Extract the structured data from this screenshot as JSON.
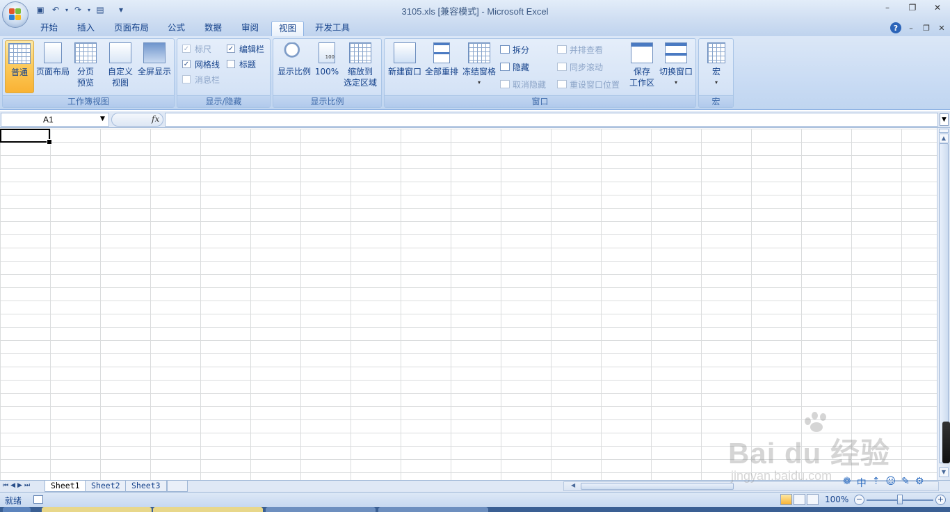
{
  "window": {
    "title": "3105.xls  [兼容模式] - Microsoft Excel",
    "controls": {
      "minimize": "–",
      "maximize": "❐",
      "close": "✕"
    }
  },
  "quick_access": {
    "icons": [
      "save-icon",
      "undo-icon",
      "redo-icon",
      "print-preview-icon",
      "customize-dropdown-icon"
    ],
    "glyphs": {
      "save": "▣",
      "undo": "↶",
      "redo": "↷",
      "preview": "▤",
      "customize": "▾",
      "sep": "▾"
    }
  },
  "tabs": [
    {
      "label": "开始"
    },
    {
      "label": "插入"
    },
    {
      "label": "页面布局"
    },
    {
      "label": "公式"
    },
    {
      "label": "数据"
    },
    {
      "label": "审阅"
    },
    {
      "label": "视图",
      "active": true
    },
    {
      "label": "开发工具"
    }
  ],
  "mdi_controls": {
    "help": "?",
    "minimize": "–",
    "restore": "❐",
    "close": "✕"
  },
  "ribbon": {
    "workbook_views": {
      "group_label": "工作簿视图",
      "normal": "普通",
      "page_layout": "页面布局",
      "page_break_1": "分页",
      "page_break_2": "预览",
      "custom_1": "自定义",
      "custom_2": "视图",
      "full_screen": "全屏显示"
    },
    "show_hide": {
      "group_label": "显示/隐藏",
      "ruler": "标尺",
      "gridlines": "网格线",
      "message_bar": "消息栏",
      "formula_bar": "编辑栏",
      "headings": "标题",
      "check": "✓"
    },
    "zoom": {
      "group_label": "显示比例",
      "zoom": "显示比例",
      "hundred": "100%",
      "hundred_icon_text": "100",
      "zoom_selection_1": "缩放到",
      "zoom_selection_2": "选定区域"
    },
    "window": {
      "group_label": "窗口",
      "new_window": "新建窗口",
      "arrange_all": "全部重排",
      "freeze_panes": "冻结窗格",
      "split": "拆分",
      "hide": "隐藏",
      "unhide": "取消隐藏",
      "side_by_side": "并排查看",
      "sync_scroll": "同步滚动",
      "reset_position": "重设窗口位置",
      "save_workspace_1": "保存",
      "save_workspace_2": "工作区",
      "switch_windows": "切换窗口",
      "dropdown": "▾"
    },
    "macros": {
      "group_label": "宏",
      "macros": "宏",
      "dropdown": "▾"
    }
  },
  "formula_bar": {
    "name_box": "A1",
    "name_box_arrow": "▼",
    "fx": "fx",
    "expand": "▼",
    "value": ""
  },
  "sheet_tabs": {
    "nav": [
      "⏮",
      "◀",
      "▶",
      "⏭"
    ],
    "tabs": [
      {
        "label": "Sheet1",
        "active": true
      },
      {
        "label": "Sheet2"
      },
      {
        "label": "Sheet3"
      }
    ]
  },
  "scrollbars": {
    "up": "▲",
    "down": "▼",
    "left": "◀"
  },
  "status": {
    "ready": "就绪",
    "zoom_level": "100%",
    "zoom_minus": "−",
    "zoom_plus": "+",
    "zoom_fraction": 0.5
  },
  "watermark": {
    "brand": "Bai du 经验",
    "url": "jingyan.baidu.com"
  },
  "float_tools": [
    "❁",
    "中",
    "⇡",
    "☺",
    "✎",
    "⚙"
  ],
  "colors": {
    "accent": "#15428b",
    "ribbon_bg": "#c7daf3",
    "selected": "#f9b233"
  }
}
